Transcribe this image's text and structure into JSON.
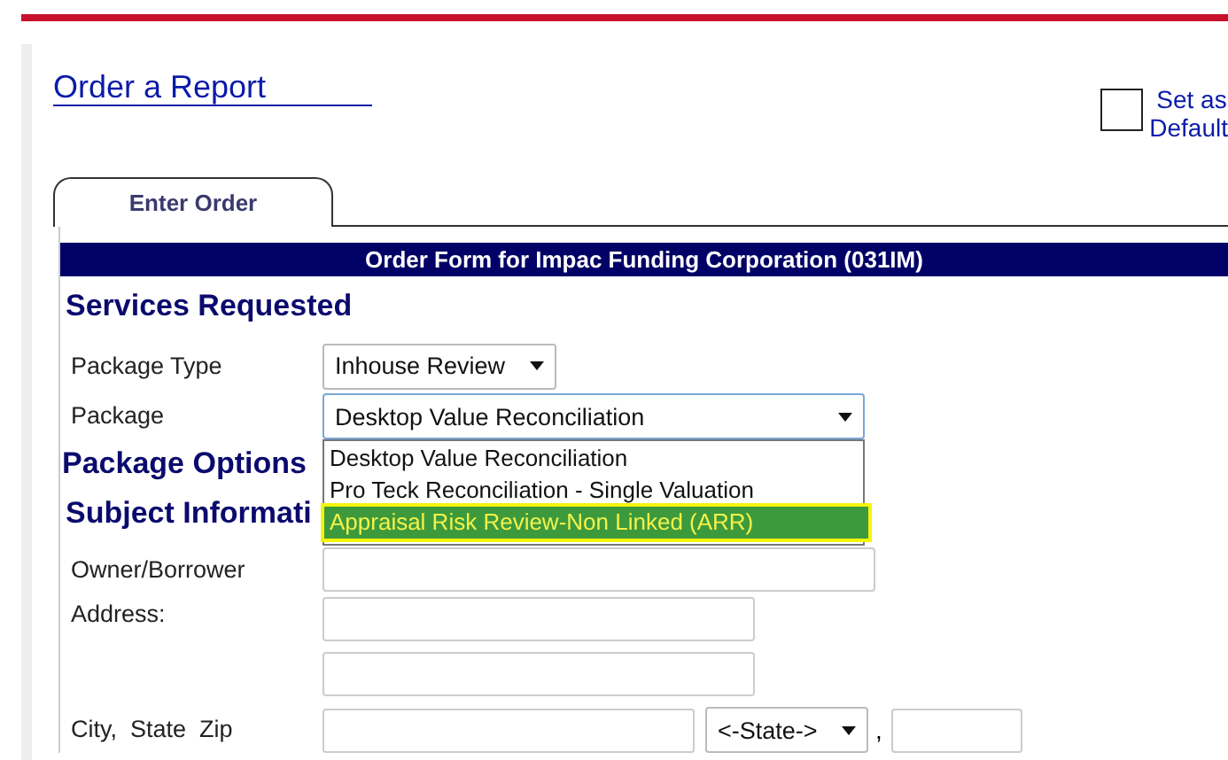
{
  "title": "Order a Report",
  "set_default": {
    "label_1": "Set as",
    "label_2": "Default",
    "checked": false
  },
  "tabs": [
    {
      "label": "Enter Order",
      "selected": true
    }
  ],
  "form_title": "Order Form for Impac Funding Corporation (031IM)",
  "services_heading": "Services Requested",
  "package_type": {
    "label": "Package Type",
    "value": "Inhouse Review"
  },
  "package": {
    "label": "Package",
    "value": "Desktop Value Reconciliation",
    "expanded": true,
    "options": [
      {
        "label": "Desktop Value Reconciliation",
        "highlighted": false
      },
      {
        "label": "Pro Teck Reconciliation - Single Valuation",
        "highlighted": false
      },
      {
        "label": "Appraisal Risk Review-Non Linked (ARR)",
        "highlighted": true
      }
    ]
  },
  "package_options_heading": "Package Options",
  "subject_heading": "Subject Informati",
  "owner_label": "Owner/Borrower",
  "address_label": "Address:",
  "city_label": "City,  State  Zip",
  "state_value": "<-State->",
  "comma": ","
}
